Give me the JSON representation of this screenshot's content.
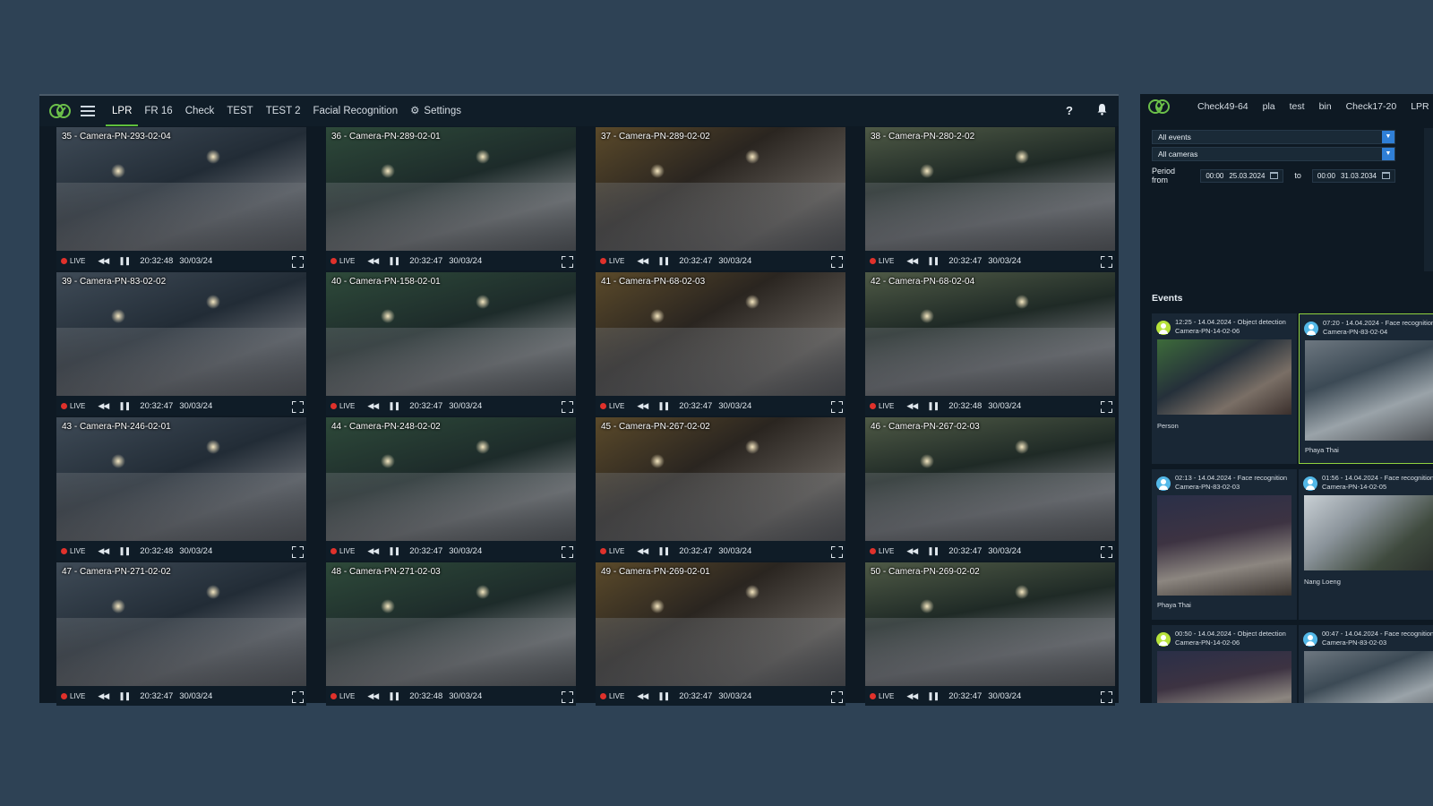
{
  "main": {
    "tabs": [
      {
        "label": "LPR",
        "active": true
      },
      {
        "label": "FR 16"
      },
      {
        "label": "Check"
      },
      {
        "label": "TEST"
      },
      {
        "label": "TEST 2"
      },
      {
        "label": "Facial Recognition"
      },
      {
        "label": "Settings",
        "icon": "gear-icon"
      }
    ],
    "help_label": "?",
    "icons": [
      "logo-icon",
      "menu-icon",
      "gear-icon",
      "help-icon",
      "bell-icon"
    ],
    "live_label": "LIVE",
    "cameras": [
      {
        "title": "35 - Camera-PN-293-02-04",
        "time": "20:32:48",
        "date": "30/03/24"
      },
      {
        "title": "36 - Camera-PN-289-02-01",
        "time": "20:32:47",
        "date": "30/03/24"
      },
      {
        "title": "37 - Camera-PN-289-02-02",
        "time": "20:32:47",
        "date": "30/03/24"
      },
      {
        "title": "38 - Camera-PN-280-2-02",
        "time": "20:32:47",
        "date": "30/03/24"
      },
      {
        "title": "39 - Camera-PN-83-02-02",
        "time": "20:32:47",
        "date": "30/03/24"
      },
      {
        "title": "40 - Camera-PN-158-02-01",
        "time": "20:32:47",
        "date": "30/03/24"
      },
      {
        "title": "41 - Camera-PN-68-02-03",
        "time": "20:32:47",
        "date": "30/03/24"
      },
      {
        "title": "42 - Camera-PN-68-02-04",
        "time": "20:32:48",
        "date": "30/03/24"
      },
      {
        "title": "43 - Camera-PN-246-02-01",
        "time": "20:32:48",
        "date": "30/03/24"
      },
      {
        "title": "44 - Camera-PN-248-02-02",
        "time": "20:32:47",
        "date": "30/03/24"
      },
      {
        "title": "45 - Camera-PN-267-02-02",
        "time": "20:32:47",
        "date": "30/03/24"
      },
      {
        "title": "46 - Camera-PN-267-02-03",
        "time": "20:32:47",
        "date": "30/03/24"
      },
      {
        "title": "47 - Camera-PN-271-02-02",
        "time": "20:32:47",
        "date": "30/03/24"
      },
      {
        "title": "48 - Camera-PN-271-02-03",
        "time": "20:32:48",
        "date": "30/03/24"
      },
      {
        "title": "49 - Camera-PN-269-02-01",
        "time": "20:32:47",
        "date": "30/03/24"
      },
      {
        "title": "50 - Camera-PN-269-02-02",
        "time": "20:32:47",
        "date": "30/03/24"
      }
    ]
  },
  "side": {
    "tabs": [
      "Check49-64",
      "pla",
      "test",
      "bin",
      "Check17-20",
      "LPR"
    ],
    "filters": {
      "events": "All events",
      "cameras": "All cameras",
      "period_label": "Period from",
      "from_time": "00:00",
      "from_date": "25.03.2024",
      "to_label": "to",
      "to_time": "00:00",
      "to_date": "31.03.2034"
    },
    "events_title": "Events",
    "events": [
      {
        "line1": "12:25 - 14.04.2024 - Object detection",
        "line2": "Camera-PN-14-02-06",
        "label": "Person",
        "kind": "person"
      },
      {
        "line1": "07:20 - 14.04.2024 - Face recognition",
        "line2": "Camera-PN-83-02-04",
        "label": "Phaya Thai",
        "kind": "face"
      },
      {
        "line1": "02:13 - 14.04.2024 - Face recognition",
        "line2": "Camera-PN-83-02-03",
        "label": "Phaya Thai",
        "kind": "face"
      },
      {
        "line1": "01:56 - 14.04.2024 - Face recognition",
        "line2": "Camera-PN-14-02-05",
        "label": "Nang Loeng",
        "kind": "face"
      },
      {
        "line1": "00:50 - 14.04.2024 - Object detection",
        "line2": "Camera-PN-14-02-06",
        "label": "",
        "kind": "person"
      },
      {
        "line1": "00:47 - 14.04.2024 - Face recognition",
        "line2": "Camera-PN-83-02-03",
        "label": "",
        "kind": "face"
      }
    ]
  }
}
